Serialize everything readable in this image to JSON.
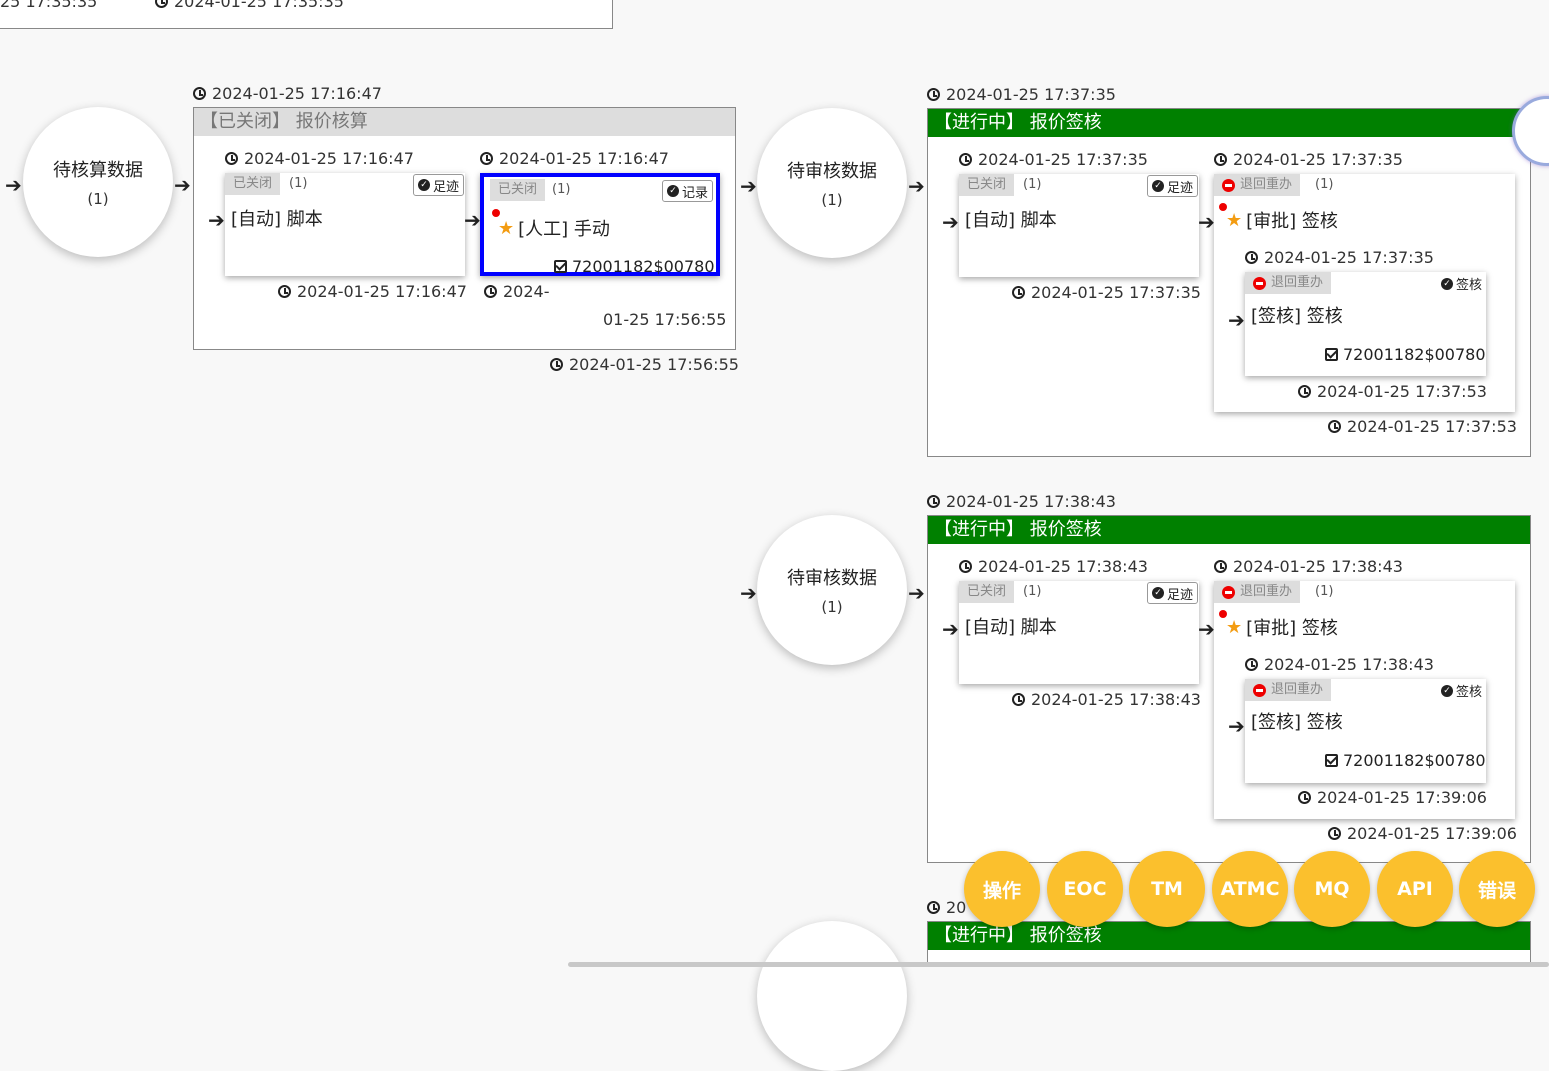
{
  "top_partial": {
    "ts1": "25 17:35:35",
    "ts2": "2024-01-25 17:35:35"
  },
  "row1": {
    "circle1": {
      "label": "待核算数据",
      "count": "(1)"
    },
    "stageA": {
      "ts_top": "2024-01-25 17:16:47",
      "header": "【已关闭】 报价核算",
      "ts_bottom": "2024-01-25 17:56:55",
      "card1": {
        "ts_top": "2024-01-25 17:16:47",
        "tag": "已关闭",
        "count": "(1)",
        "action": "足迹",
        "title": "[自动] 脚本",
        "ts_bottom": "2024-01-25 17:16:47"
      },
      "card2": {
        "ts_top": "2024-01-25 17:16:47",
        "tag": "已关闭",
        "count": "(1)",
        "action": "记录",
        "title": "[人工] 手动",
        "owner": "72001182$00780",
        "ts_bottom_a": "2024-",
        "ts_bottom_b": "01-25 17:56:55"
      }
    },
    "circle2": {
      "label": "待审核数据",
      "count": "(1)"
    },
    "stageB": {
      "ts_top": "2024-01-25 17:37:35",
      "header": "【进行中】 报价签核",
      "ts_bottom": "2024-01-25 17:37:53",
      "card1": {
        "ts_top": "2024-01-25 17:37:35",
        "tag": "已关闭",
        "count": "(1)",
        "action": "足迹",
        "title": "[自动] 脚本",
        "ts_bottom": "2024-01-25 17:37:35"
      },
      "card2": {
        "ts_top": "2024-01-25 17:37:35",
        "tag": "退回重办",
        "count": "(1)",
        "title": "[审批] 签核",
        "ts_bottom": "2024-01-25 17:37:53",
        "sub": {
          "ts_top": "2024-01-25 17:37:35",
          "tag": "退回重办",
          "action": "签核",
          "title": "[签核] 签核",
          "owner": "72001182$00780",
          "ts_bottom": "2024-01-25 17:37:53"
        }
      }
    }
  },
  "row2": {
    "circle": {
      "label": "待审核数据",
      "count": "(1)"
    },
    "stage": {
      "ts_top": "2024-01-25 17:38:43",
      "header": "【进行中】 报价签核",
      "ts_bottom": "2024-01-25 17:39:06",
      "card1": {
        "ts_top": "2024-01-25 17:38:43",
        "tag": "已关闭",
        "count": "(1)",
        "action": "足迹",
        "title": "[自动] 脚本",
        "ts_bottom": "2024-01-25 17:38:43"
      },
      "card2": {
        "ts_top": "2024-01-25 17:38:43",
        "tag": "退回重办",
        "count": "(1)",
        "title": "[审批] 签核",
        "ts_bottom": "2024-01-25 17:39:06",
        "sub": {
          "ts_top": "2024-01-25 17:38:43",
          "tag": "退回重办",
          "action": "签核",
          "title": "[签核] 签核",
          "owner": "72001182$00780",
          "ts_bottom": "2024-01-25 17:39:06"
        }
      }
    }
  },
  "row3": {
    "ts_top": "20",
    "header": "【进行中】 报价签核"
  },
  "fabs": [
    "操作",
    "EOC",
    "TM",
    "ATMC",
    "MQ",
    "API",
    "错误"
  ],
  "colors": {
    "active": "#008000",
    "fab": "#fbc02d",
    "selected": "#0000ff"
  }
}
